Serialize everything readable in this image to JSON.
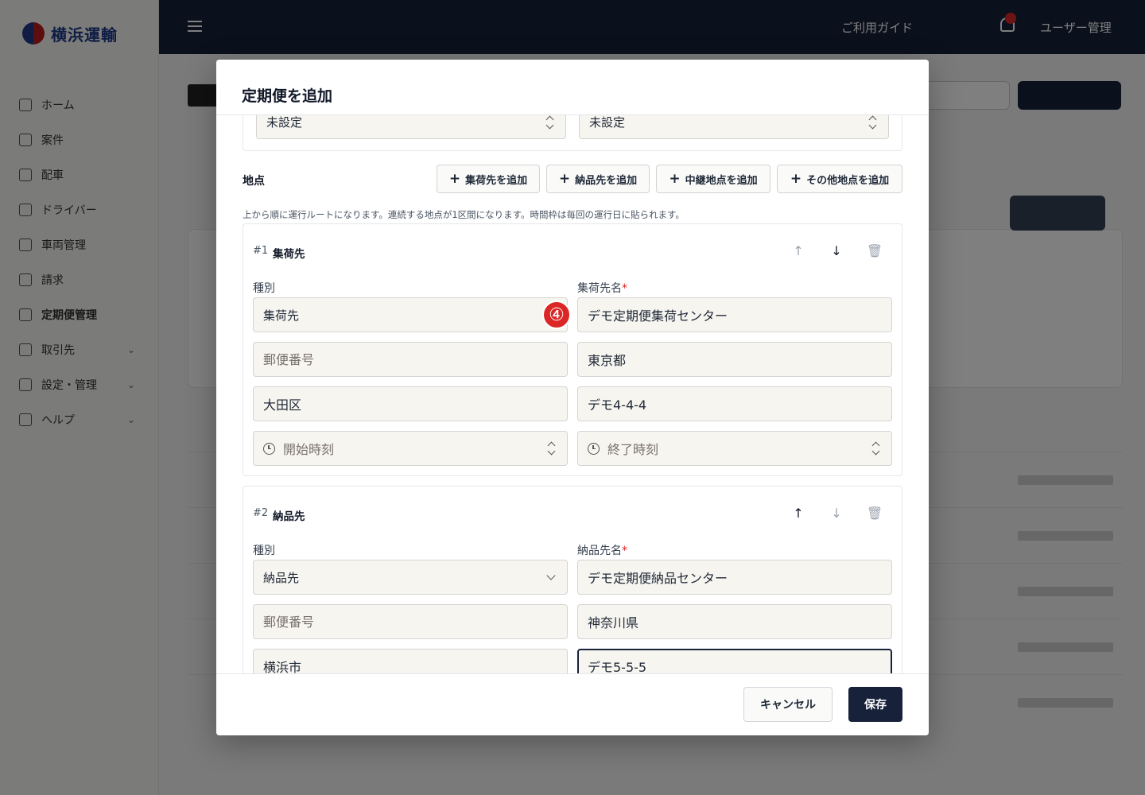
{
  "background": {
    "logo_text": "横浜運輸",
    "nav_items": [
      {
        "label": "ホーム"
      },
      {
        "label": "案件"
      },
      {
        "label": "配車"
      },
      {
        "label": "ドライバー"
      },
      {
        "label": "車両管理"
      },
      {
        "label": "請求"
      },
      {
        "label": "定期便管理"
      },
      {
        "label": "取引先"
      },
      {
        "label": "設定・管理"
      },
      {
        "label": "ヘルプ"
      }
    ],
    "topbar_link": "ご利用ガイド",
    "topbar_user": "ユーザー管理"
  },
  "modal": {
    "title": "定期便を追加",
    "prev_selects": [
      "未設定",
      "未設定"
    ],
    "locations_label": "地点",
    "add_buttons": [
      "集荷先を追加",
      "納品先を追加",
      "中継地点を追加",
      "その他地点を追加"
    ],
    "hint": "上から順に運行ルートになります。連続する地点が1区間になります。時間枠は毎回の運行日に貼られます。",
    "stops": [
      {
        "num": "#1",
        "type": "集荷先",
        "kind_label": "種別",
        "kind_value": "集荷先",
        "name_label": "集荷先名",
        "name_value": "デモ定期便集荷センター",
        "postal_placeholder": "郵便番号",
        "prefecture": "東京都",
        "city": "大田区",
        "address": "デモ4-4-4",
        "start_time_placeholder": "開始時刻",
        "end_time_placeholder": "終了時刻"
      },
      {
        "num": "#2",
        "type": "納品先",
        "kind_label": "種別",
        "kind_value": "納品先",
        "name_label": "納品先名",
        "name_value": "デモ定期便納品センター",
        "postal_placeholder": "郵便番号",
        "prefecture": "神奈川県",
        "city": "横浜市",
        "address": "デモ5-5-5"
      }
    ],
    "required_mark": "*",
    "badge": "④",
    "cancel_label": "キャンセル",
    "save_label": "保存"
  }
}
